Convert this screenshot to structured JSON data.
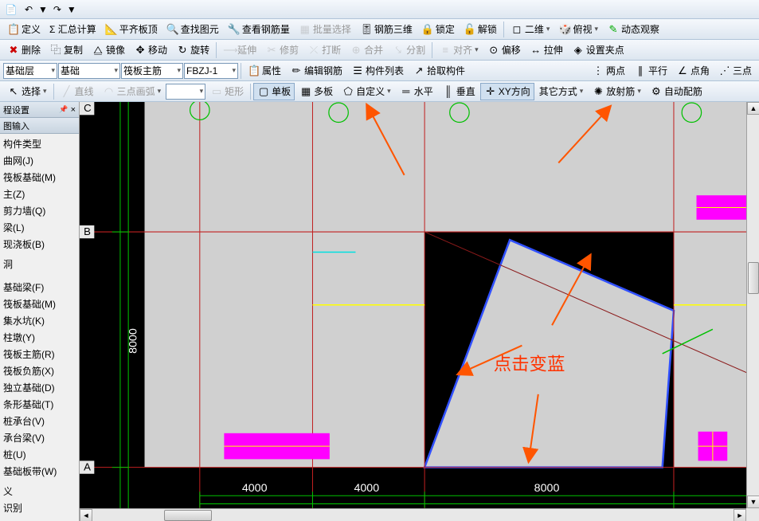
{
  "qa": {
    "undo": "↶",
    "redo": "↷"
  },
  "toolbar1": {
    "define": "定义",
    "sum_calc": "Σ 汇总计算",
    "level_top": "平齐板顶",
    "find_elem": "查找图元",
    "check_rebar": "查看钢筋量",
    "batch_select": "批量选择",
    "rebar_3d": "钢筋三维",
    "lock": "锁定",
    "unlock": "解锁",
    "view_2d": "二维",
    "perspective": "俯视",
    "dynamic_view": "动态观察"
  },
  "toolbar2": {
    "delete": "删除",
    "copy": "复制",
    "mirror": "镜像",
    "move": "移动",
    "rotate": "旋转",
    "extend": "延伸",
    "trim": "修剪",
    "break": "打断",
    "merge": "合并",
    "split": "分割",
    "align": "对齐",
    "offset": "偏移",
    "stretch": "拉伸",
    "set_grip": "设置夹点"
  },
  "toolbar3": {
    "combo1": "基础层",
    "combo2": "基础",
    "combo3": "筏板主筋",
    "combo4": "FBZJ-1",
    "property": "属性",
    "edit_rebar": "编辑钢筋",
    "component_list": "构件列表",
    "pick_component": "拾取构件",
    "two_points": "两点",
    "parallel": "平行",
    "point_angle": "点角",
    "three_point": "三点"
  },
  "toolbar4": {
    "select": "选择",
    "line": "直线",
    "arc3": "三点画弧",
    "rect": "矩形",
    "single_board": "单板",
    "multi_board": "多板",
    "custom": "自定义",
    "horizontal": "水平",
    "vertical": "垂直",
    "xy_direction": "XY方向",
    "other_way": "其它方式",
    "radiate": "放射筋",
    "auto_fit": "自动配筋"
  },
  "sidebar": {
    "title1": "程设置",
    "title2": "图输入",
    "items": [
      "构件类型",
      "曲网(J)",
      "筏板基础(M)",
      "主(Z)",
      "剪力墙(Q)",
      "梁(L)",
      "现浇板(B)",
      "",
      "洞",
      "",
      "",
      "基础梁(F)",
      "筏板基础(M)",
      "集水坑(K)",
      "柱墩(Y)",
      "筏板主筋(R)",
      "筏板负筋(X)",
      "独立基础(D)",
      "条形基础(T)",
      "桩承台(V)",
      "承台梁(V)",
      "桩(U)",
      "基础板带(W)",
      "",
      "义",
      "识别"
    ],
    "pin": "📌",
    "close": "×"
  },
  "canvas": {
    "axis_labels": {
      "A": "A",
      "B": "B",
      "C": "C"
    },
    "dimensions": {
      "d1": "4000",
      "d2": "4000",
      "d3": "8000",
      "v1": "8000"
    },
    "annotation": "点击变蓝"
  },
  "colors": {
    "grid_red": "#c02020",
    "blue_select": "#3050ff",
    "magenta": "#ff00ff",
    "yellow": "#ffff00",
    "green": "#00c000",
    "orange": "#ff5500",
    "cyan": "#00e0e0",
    "lightgray": "#d0d0d0"
  }
}
